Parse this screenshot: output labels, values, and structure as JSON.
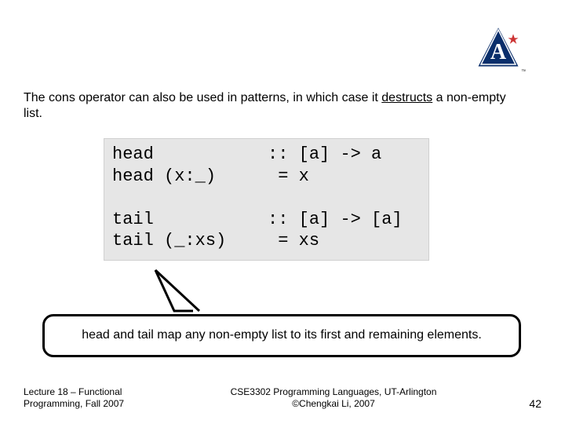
{
  "intro": {
    "pre": "The cons operator can also be used in patterns, in which case it ",
    "underlined": "destructs",
    "post": " a non-empty list."
  },
  "code": {
    "line1": "head           :: [a] -> a",
    "line2": "head (x:_)      = x",
    "blank": "",
    "line3": "tail           :: [a] -> [a]",
    "line4": "tail (_:xs)     = xs"
  },
  "callout": "head and tail map any non-empty list to its first and remaining elements.",
  "footer": {
    "left_line1": "Lecture 18 – Functional",
    "left_line2": "Programming, Fall 2007",
    "center_line1": "CSE3302 Programming Languages, UT-Arlington",
    "center_line2": "©Chengkai Li, 2007",
    "page": "42"
  },
  "logo": {
    "letter": "A"
  }
}
